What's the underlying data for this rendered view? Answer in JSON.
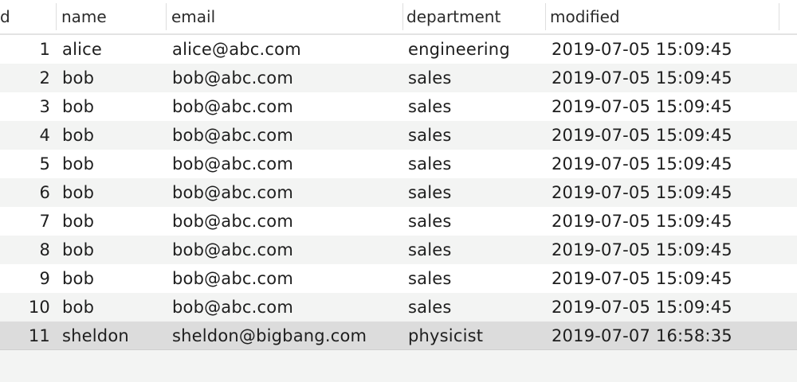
{
  "columns": {
    "id": "d",
    "name": "name",
    "email": "email",
    "department": "department",
    "modified": "modified"
  },
  "rows": [
    {
      "id": "1",
      "name": "alice",
      "email": "alice@abc.com",
      "department": "engineering",
      "modified": "2019-07-05 15:09:45"
    },
    {
      "id": "2",
      "name": "bob",
      "email": "bob@abc.com",
      "department": "sales",
      "modified": "2019-07-05 15:09:45"
    },
    {
      "id": "3",
      "name": "bob",
      "email": "bob@abc.com",
      "department": "sales",
      "modified": "2019-07-05 15:09:45"
    },
    {
      "id": "4",
      "name": "bob",
      "email": "bob@abc.com",
      "department": "sales",
      "modified": "2019-07-05 15:09:45"
    },
    {
      "id": "5",
      "name": "bob",
      "email": "bob@abc.com",
      "department": "sales",
      "modified": "2019-07-05 15:09:45"
    },
    {
      "id": "6",
      "name": "bob",
      "email": "bob@abc.com",
      "department": "sales",
      "modified": "2019-07-05 15:09:45"
    },
    {
      "id": "7",
      "name": "bob",
      "email": "bob@abc.com",
      "department": "sales",
      "modified": "2019-07-05 15:09:45"
    },
    {
      "id": "8",
      "name": "bob",
      "email": "bob@abc.com",
      "department": "sales",
      "modified": "2019-07-05 15:09:45"
    },
    {
      "id": "9",
      "name": "bob",
      "email": "bob@abc.com",
      "department": "sales",
      "modified": "2019-07-05 15:09:45"
    },
    {
      "id": "10",
      "name": "bob",
      "email": "bob@abc.com",
      "department": "sales",
      "modified": "2019-07-05 15:09:45"
    },
    {
      "id": "11",
      "name": "sheldon",
      "email": "sheldon@bigbang.com",
      "department": "physicist",
      "modified": "2019-07-07 16:58:35"
    }
  ],
  "selected_row": 11,
  "colors": {
    "row_even": "#ffffff",
    "row_odd": "#f3f4f3",
    "row_selected": "#dcdcdc"
  }
}
